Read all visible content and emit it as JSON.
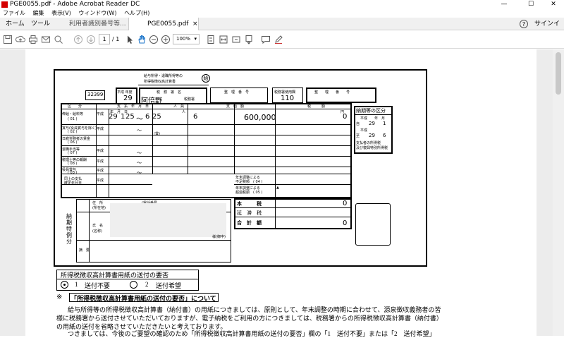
{
  "window": {
    "title": "PGE0055.pdf - Adobe Acrobat Reader DC",
    "min": "—",
    "max": "☐",
    "close": "✕"
  },
  "menu": [
    "ファイル",
    "編集",
    "表示(V)",
    "ウィンドウ(W)",
    "ヘルプ(H)"
  ],
  "tabs": {
    "home": "ホーム",
    "tools": "ツール",
    "doc1": "利用者識別番号等...",
    "doc2": "PGE0055.pdf",
    "doc2_close": "×",
    "help": "?",
    "signin": "サインイン"
  },
  "toolbar": {
    "page_current": "1",
    "page_total": "/ 1",
    "zoom": "100%",
    "zoom_arrow": "▾",
    "icons": [
      "save-icon",
      "upload-icon",
      "print-icon",
      "mail-icon",
      "search-icon",
      "prev-page-icon",
      "next-page-icon",
      "select-cursor-icon",
      "hand-tool-icon",
      "zoom-out-icon",
      "zoom-in-icon",
      "fit-page-icon",
      "fit-width-icon",
      "rotate-icon",
      "scroll-icon",
      "comment-icon",
      "pen-icon"
    ]
  },
  "form": {
    "title_line1": "給与所得・退職所得等の",
    "title_line2": "所得税徴収高計算書",
    "kyu_mark": "給",
    "code": "32399",
    "nendo_label": "平成 年度",
    "nendo_value": "29",
    "zeimusho_label": "税　務　署　名",
    "zeimusho_value": "阿倍野",
    "zeimusho_suffix": "税務署",
    "seirishomei_label": "整　理　番　号",
    "zeimushoshiyou_label": "税務署使用欄",
    "zeimushoshiyou_value": "110",
    "seiri_label": "整　　理　　番　　号",
    "col_kubun": "区　　分",
    "col_shikyu": "支　払　年　月　日",
    "col_jinin": "人　員",
    "col_shikyugaku": "支　給　額",
    "col_zeigaku": "税　　　額",
    "row1_label": "俸給・給料等",
    "row1_code": "( 01 )",
    "row1_era": "平成",
    "row1_y": "29",
    "row1_m": "1",
    "row1_d": "25",
    "row1_tilde": "〜",
    "row1_m2": "6",
    "row1_d2": "25",
    "row1_people": "6",
    "row1_amount": "600,000",
    "row1_tax": "0",
    "unit_nin": "人",
    "unit_en": "円",
    "unit_ymd": "年　月　日",
    "row2_label": "賞与(役員賞与を除く)",
    "row2_code": "( 02 )",
    "row3_label": "日雇労務者の賃金",
    "row3_code": "( 06 )",
    "row4_label": "退職手当等",
    "row4_code": "( 07 )",
    "row5_label": "税理士等の報酬",
    "row5_code": "( 08 )",
    "row6_label": "役員賞与",
    "row6_code": "( 03 )",
    "row7_label1": "同上の支払",
    "row7_label2": "確定年月日",
    "era": "平成",
    "tilde": "〜",
    "kakko_sho": "(賞)",
    "nenmatsu1a": "年末調整による",
    "nenmatsu1b": "不足税額　( 04 )",
    "nenmatsu2a": "年末調整による",
    "nenmatsu2b": "超過税額　( 05 )",
    "triangle": "▲",
    "honzei_label": "本　　　税",
    "honzei_value": "0",
    "entai_label": "延　滞　税",
    "gokei_label": "合　計　額",
    "gokei_value": "0",
    "noki_title": "納期等の区分",
    "noki_from_label": "自",
    "noki_year_label": "平成　　年　月",
    "noki_from_y": "29",
    "noki_from_m": "1",
    "noki_era": "平成",
    "noki_to_label": "至",
    "noki_to_y": "29",
    "noki_to_m": "6",
    "noki_note1": "支払者の所得税",
    "noki_note2": "及び復興特別所得税",
    "nouki_side": "納期特例分",
    "addr_label": "住　所",
    "addr_sub": "(所在地)",
    "tel_label": "(電話番号",
    "name_label": "氏　名",
    "name_sub": "(名称)",
    "seal_label": "様(御中)",
    "tekiyo_label": "摘　要"
  },
  "request": {
    "heading": "所得税徴収高計算書用紙の送付の要否",
    "opt1_num": "1",
    "opt1_label": "送付不要",
    "opt2_num": "2",
    "opt2_label": "送付希望"
  },
  "notice": {
    "mark": "※",
    "title": "「所得税徴収高計算書用紙の送付の要否」について",
    "line1": "給与所得等の所得税徴収高計算書（納付書）の用紙につきましては、原則として、年末調整の時期に合わせて、源泉徴収義務者の皆",
    "line2": "様に税務署から送付させていただいておりますが、電子納税をご利用の方につきましては、税務署からの所得税徴収高計算書（納付書）",
    "line3": "の用紙の送付を省略させていただきたいと考えております。",
    "line4": "つきましては、今後のご要望の確認のため「所得税徴収高計算書用紙の送付の要否」欄の「1　送付不要」または「2　送付希望」"
  }
}
